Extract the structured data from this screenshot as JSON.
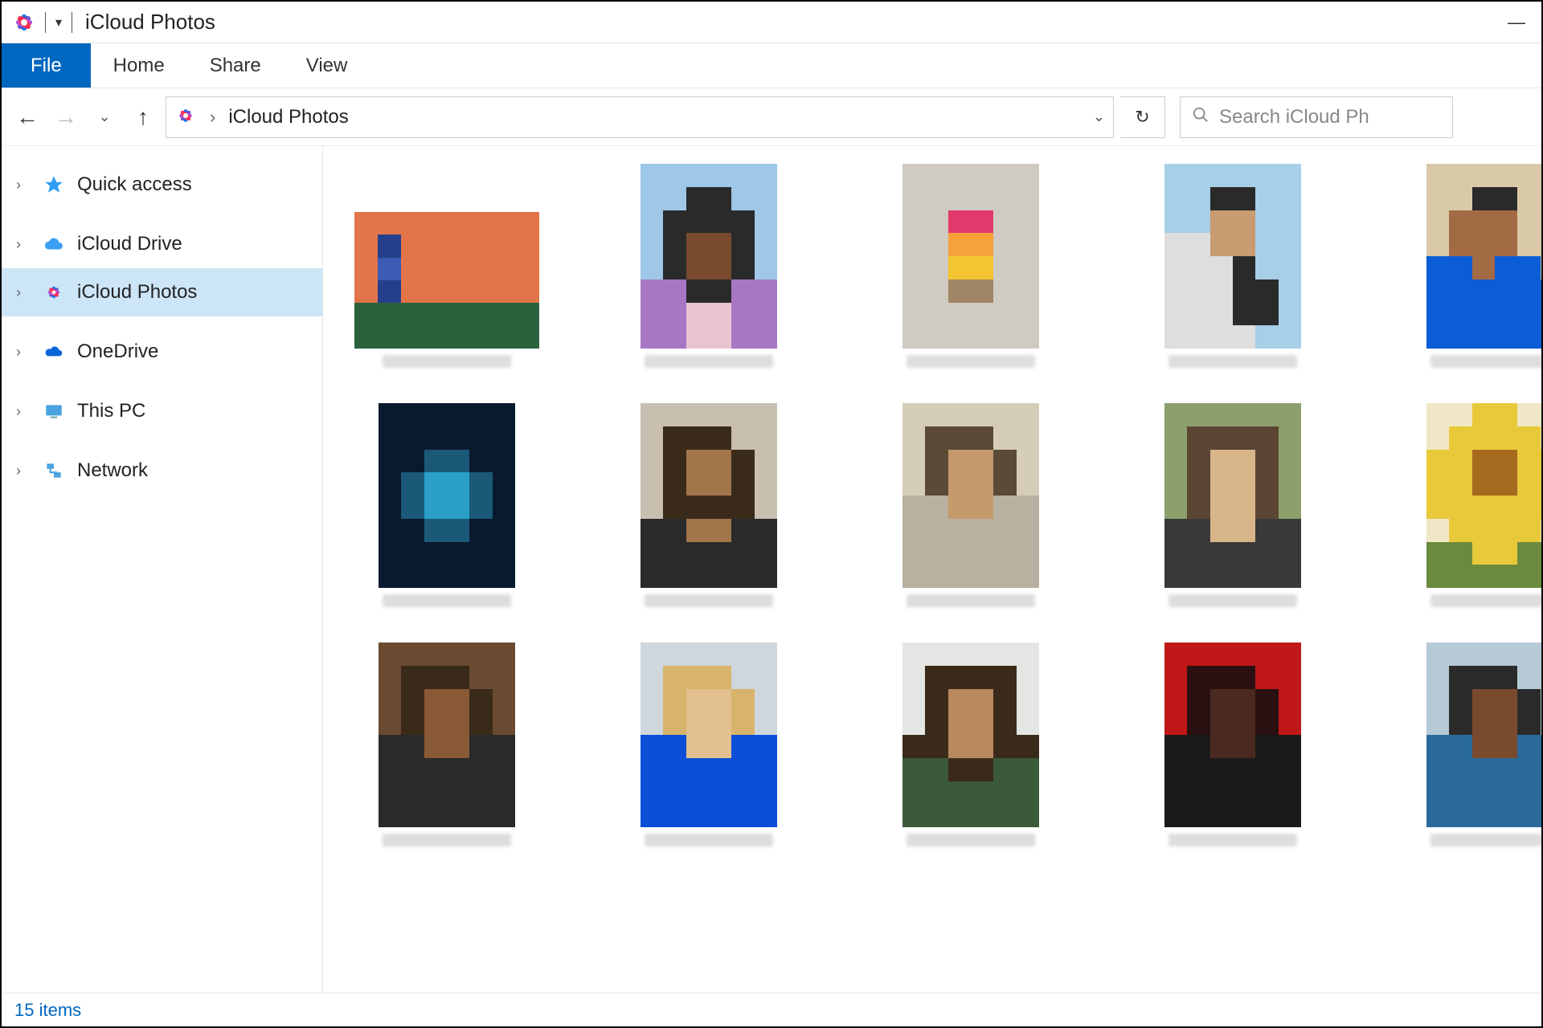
{
  "window": {
    "title": "iCloud Photos"
  },
  "ribbon": {
    "file": "File",
    "tabs": [
      "Home",
      "Share",
      "View"
    ]
  },
  "address": {
    "crumbs": [
      "iCloud Photos"
    ],
    "search_placeholder": "Search iCloud Ph"
  },
  "sidebar": {
    "items": [
      {
        "label": "Quick access",
        "icon": "star"
      },
      {
        "label": "iCloud Drive",
        "icon": "cloud"
      },
      {
        "label": "iCloud Photos",
        "icon": "photos",
        "selected": true
      },
      {
        "label": "OneDrive",
        "icon": "onedrive"
      },
      {
        "label": "This PC",
        "icon": "pc"
      },
      {
        "label": "Network",
        "icon": "network"
      }
    ]
  },
  "status": {
    "text": "15 items"
  },
  "thumbs": [
    {
      "shape": "landscape",
      "palette": [
        "#e2744a",
        "#e2744a",
        "#e2744a",
        "#e2744a",
        "#e2744a",
        "#e2744a",
        "#e2744a",
        "#e2744a",
        "#e2744a",
        "#25408a",
        "#e2744a",
        "#e2744a",
        "#e2744a",
        "#e2744a",
        "#e2744a",
        "#e2744a",
        "#e2744a",
        "#3b5bb5",
        "#e2744a",
        "#e2744a",
        "#e2744a",
        "#e2744a",
        "#e2744a",
        "#e2744a",
        "#e2744a",
        "#263f8a",
        "#e2744a",
        "#e2744a",
        "#e2744a",
        "#e2744a",
        "#e2744a",
        "#e2744a",
        "#2a623d",
        "#2a623d",
        "#2a623d",
        "#2a623d",
        "#2a623d",
        "#2a623d",
        "#2a623d",
        "#2a623d",
        "#2a623d",
        "#2a623d",
        "#2a623d",
        "#2a623d",
        "#2a623d",
        "#2a623d",
        "#2a623d",
        "#2a623d"
      ]
    },
    {
      "shape": "portrait",
      "palette": [
        "#9ec7e8",
        "#9ec7e8",
        "#9ec7e8",
        "#9ec7e8",
        "#9ec7e8",
        "#9ec7e8",
        "#9ec7e8",
        "#9ec7e8",
        "#2a2a2a",
        "#2a2a2a",
        "#9ec7e8",
        "#9ec7e8",
        "#9ec7e8",
        "#2a2a2a",
        "#2a2a2a",
        "#2a2a2a",
        "#2a2a2a",
        "#9ec7e8",
        "#9ec7e8",
        "#2a2a2a",
        "#7a4a2f",
        "#7a4a2f",
        "#2a2a2a",
        "#9ec7e8",
        "#9ec7e8",
        "#2a2a2a",
        "#7a4a2f",
        "#7a4a2f",
        "#2a2a2a",
        "#9ec7e8",
        "#a877c4",
        "#a877c4",
        "#2a2a2a",
        "#2a2a2a",
        "#a877c4",
        "#a877c4",
        "#a877c4",
        "#a877c4",
        "#eac3d2",
        "#eac3d2",
        "#a877c4",
        "#a877c4",
        "#a877c4",
        "#a877c4",
        "#eac3d2",
        "#eac3d2",
        "#a877c4",
        "#a877c4"
      ]
    },
    {
      "shape": "portrait",
      "palette": [
        "#cfcac2",
        "#cfcac2",
        "#cfcac2",
        "#cfcac2",
        "#cfcac2",
        "#cfcac2",
        "#cfcac2",
        "#cfcac2",
        "#cfcac2",
        "#cfcac2",
        "#cfcac2",
        "#cfcac2",
        "#cfcac2",
        "#cfcac2",
        "#e33a6d",
        "#e33a6d",
        "#cfcac2",
        "#cfcac2",
        "#cfcac2",
        "#cfcac2",
        "#f6a13a",
        "#f6a13a",
        "#cfcac2",
        "#cfcac2",
        "#cfcac2",
        "#cfcac2",
        "#f2c531",
        "#f2c531",
        "#cfcac2",
        "#cfcac2",
        "#cfcac2",
        "#cfcac2",
        "#a08664",
        "#a08664",
        "#cfcac2",
        "#cfcac2",
        "#cfcac2",
        "#cfcac2",
        "#cfcac2",
        "#cfcac2",
        "#cfcac2",
        "#cfcac2",
        "#cfcac2",
        "#cfcac2",
        "#cfcac2",
        "#cfcac2",
        "#cfcac2",
        "#cfcac2"
      ]
    },
    {
      "shape": "portrait",
      "palette": [
        "#a7cfe8",
        "#a7cfe8",
        "#a7cfe8",
        "#a7cfe8",
        "#a7cfe8",
        "#a7cfe8",
        "#a7cfe8",
        "#a7cfe8",
        "#2a2a2a",
        "#2a2a2a",
        "#a7cfe8",
        "#a7cfe8",
        "#a7cfe8",
        "#a7cfe8",
        "#c89b70",
        "#c89b70",
        "#a7cfe8",
        "#a7cfe8",
        "#dedede",
        "#dedede",
        "#c89b70",
        "#c89b70",
        "#a7cfe8",
        "#a7cfe8",
        "#dedede",
        "#dedede",
        "#dedede",
        "#2a2a2a",
        "#a7cfe8",
        "#a7cfe8",
        "#dedede",
        "#dedede",
        "#dedede",
        "#2a2a2a",
        "#2a2a2a",
        "#a7cfe8",
        "#dedede",
        "#dedede",
        "#dedede",
        "#2a2a2a",
        "#2a2a2a",
        "#a7cfe8",
        "#dedede",
        "#dedede",
        "#dedede",
        "#dedede",
        "#a7cfe8",
        "#a7cfe8"
      ]
    },
    {
      "shape": "portrait",
      "palette": [
        "#d9c9a8",
        "#d9c9a8",
        "#d9c9a8",
        "#d9c9a8",
        "#d9c9a8",
        "#d9c9a8",
        "#d9c9a8",
        "#d9c9a8",
        "#2a2a2a",
        "#2a2a2a",
        "#d9c9a8",
        "#d9c9a8",
        "#d9c9a8",
        "#a26b43",
        "#a26b43",
        "#a26b43",
        "#d9c9a8",
        "#d9c9a8",
        "#d9c9a8",
        "#a26b43",
        "#a26b43",
        "#a26b43",
        "#d9c9a8",
        "#d9c9a8",
        "#0b5cd6",
        "#0b5cd6",
        "#a26b43",
        "#0b5cd6",
        "#0b5cd6",
        "#d9c9a8",
        "#0b5cd6",
        "#0b5cd6",
        "#0b5cd6",
        "#0b5cd6",
        "#0b5cd6",
        "#0b5cd6",
        "#0b5cd6",
        "#0b5cd6",
        "#0b5cd6",
        "#0b5cd6",
        "#0b5cd6",
        "#0b5cd6",
        "#0b5cd6",
        "#0b5cd6",
        "#0b5cd6",
        "#0b5cd6",
        "#0b5cd6",
        "#0b5cd6"
      ]
    },
    {
      "shape": "portrait",
      "palette": [
        "#0a1a2e",
        "#0a1a2e",
        "#0a1a2e",
        "#0a1a2e",
        "#0a1a2e",
        "#0a1a2e",
        "#0a1a2e",
        "#0a1a2e",
        "#0a1a2e",
        "#0a1a2e",
        "#0a1a2e",
        "#0a1a2e",
        "#0a1a2e",
        "#0a1a2e",
        "#1a5a78",
        "#1a5a78",
        "#0a1a2e",
        "#0a1a2e",
        "#0a1a2e",
        "#1a5a78",
        "#2aa0c8",
        "#2aa0c8",
        "#1a5a78",
        "#0a1a2e",
        "#0a1a2e",
        "#1a5a78",
        "#2aa0c8",
        "#2aa0c8",
        "#1a5a78",
        "#0a1a2e",
        "#0a1a2e",
        "#0a1a2e",
        "#1a5a78",
        "#1a5a78",
        "#0a1a2e",
        "#0a1a2e",
        "#0a1a2e",
        "#0a1a2e",
        "#0a1a2e",
        "#0a1a2e",
        "#0a1a2e",
        "#0a1a2e",
        "#0a1a2e",
        "#0a1a2e",
        "#0a1a2e",
        "#0a1a2e",
        "#0a1a2e",
        "#0a1a2e"
      ]
    },
    {
      "shape": "portrait",
      "palette": [
        "#c9bfb0",
        "#c9bfb0",
        "#c9bfb0",
        "#c9bfb0",
        "#c9bfb0",
        "#c9bfb0",
        "#c9bfb0",
        "#3a2a1a",
        "#3a2a1a",
        "#3a2a1a",
        "#c9bfb0",
        "#c9bfb0",
        "#c9bfb0",
        "#3a2a1a",
        "#a2754b",
        "#a2754b",
        "#3a2a1a",
        "#c9bfb0",
        "#c9bfb0",
        "#3a2a1a",
        "#a2754b",
        "#a2754b",
        "#3a2a1a",
        "#c9bfb0",
        "#c9bfb0",
        "#3a2a1a",
        "#3a2a1a",
        "#3a2a1a",
        "#3a2a1a",
        "#c9bfb0",
        "#2a2a2a",
        "#2a2a2a",
        "#a2754b",
        "#a2754b",
        "#2a2a2a",
        "#2a2a2a",
        "#2a2a2a",
        "#2a2a2a",
        "#2a2a2a",
        "#2a2a2a",
        "#2a2a2a",
        "#2a2a2a",
        "#2a2a2a",
        "#2a2a2a",
        "#2a2a2a",
        "#2a2a2a",
        "#2a2a2a",
        "#2a2a2a"
      ]
    },
    {
      "shape": "portrait",
      "palette": [
        "#d6cdb9",
        "#d6cdb9",
        "#d6cdb9",
        "#d6cdb9",
        "#d6cdb9",
        "#d6cdb9",
        "#d6cdb9",
        "#5a4a36",
        "#5a4a36",
        "#5a4a36",
        "#d6cdb9",
        "#d6cdb9",
        "#d6cdb9",
        "#5a4a36",
        "#c59a6d",
        "#c59a6d",
        "#5a4a36",
        "#d6cdb9",
        "#d6cdb9",
        "#5a4a36",
        "#c59a6d",
        "#c59a6d",
        "#5a4a36",
        "#d6cdb9",
        "#b8b0a0",
        "#b8b0a0",
        "#c59a6d",
        "#c59a6d",
        "#b8b0a0",
        "#b8b0a0",
        "#b8b0a0",
        "#b8b0a0",
        "#b8b0a0",
        "#b8b0a0",
        "#b8b0a0",
        "#b8b0a0",
        "#b8b0a0",
        "#b8b0a0",
        "#b8b0a0",
        "#b8b0a0",
        "#b8b0a0",
        "#b8b0a0",
        "#b8b0a0",
        "#b8b0a0",
        "#b8b0a0",
        "#b8b0a0",
        "#b8b0a0",
        "#b8b0a0"
      ]
    },
    {
      "shape": "portrait",
      "palette": [
        "#8c9f6d",
        "#8c9f6d",
        "#8c9f6d",
        "#8c9f6d",
        "#8c9f6d",
        "#8c9f6d",
        "#8c9f6d",
        "#5a4633",
        "#5a4633",
        "#5a4633",
        "#5a4633",
        "#8c9f6d",
        "#8c9f6d",
        "#5a4633",
        "#d9b58a",
        "#d9b58a",
        "#5a4633",
        "#8c9f6d",
        "#8c9f6d",
        "#5a4633",
        "#d9b58a",
        "#d9b58a",
        "#5a4633",
        "#8c9f6d",
        "#8c9f6d",
        "#5a4633",
        "#d9b58a",
        "#d9b58a",
        "#5a4633",
        "#8c9f6d",
        "#3a3a3a",
        "#3a3a3a",
        "#d9b58a",
        "#d9b58a",
        "#3a3a3a",
        "#3a3a3a",
        "#3a3a3a",
        "#3a3a3a",
        "#3a3a3a",
        "#3a3a3a",
        "#3a3a3a",
        "#3a3a3a",
        "#3a3a3a",
        "#3a3a3a",
        "#3a3a3a",
        "#3a3a3a",
        "#3a3a3a",
        "#3a3a3a"
      ]
    },
    {
      "shape": "portrait",
      "palette": [
        "#efe7c5",
        "#efe7c5",
        "#e8c93a",
        "#e8c93a",
        "#efe7c5",
        "#efe7c5",
        "#efe7c5",
        "#e8c93a",
        "#e8c93a",
        "#e8c93a",
        "#e8c93a",
        "#efe7c5",
        "#e8c93a",
        "#e8c93a",
        "#a66a1f",
        "#a66a1f",
        "#e8c93a",
        "#e8c93a",
        "#e8c93a",
        "#e8c93a",
        "#a66a1f",
        "#a66a1f",
        "#e8c93a",
        "#e8c93a",
        "#e8c93a",
        "#e8c93a",
        "#e8c93a",
        "#e8c93a",
        "#e8c93a",
        "#e8c93a",
        "#efe7c5",
        "#e8c93a",
        "#e8c93a",
        "#e8c93a",
        "#e8c93a",
        "#efe7c5",
        "#6a8a3e",
        "#6a8a3e",
        "#e8c93a",
        "#e8c93a",
        "#6a8a3e",
        "#6a8a3e",
        "#6a8a3e",
        "#6a8a3e",
        "#6a8a3e",
        "#6a8a3e",
        "#6a8a3e",
        "#6a8a3e"
      ]
    },
    {
      "shape": "portrait",
      "palette": [
        "#6a4a30",
        "#6a4a30",
        "#6a4a30",
        "#6a4a30",
        "#6a4a30",
        "#6a4a30",
        "#6a4a30",
        "#3a2a1a",
        "#3a2a1a",
        "#3a2a1a",
        "#6a4a30",
        "#6a4a30",
        "#6a4a30",
        "#3a2a1a",
        "#8a5a36",
        "#8a5a36",
        "#3a2a1a",
        "#6a4a30",
        "#6a4a30",
        "#3a2a1a",
        "#8a5a36",
        "#8a5a36",
        "#3a2a1a",
        "#6a4a30",
        "#2a2a2a",
        "#2a2a2a",
        "#8a5a36",
        "#8a5a36",
        "#2a2a2a",
        "#2a2a2a",
        "#2a2a2a",
        "#2a2a2a",
        "#2a2a2a",
        "#2a2a2a",
        "#2a2a2a",
        "#2a2a2a",
        "#2a2a2a",
        "#2a2a2a",
        "#2a2a2a",
        "#2a2a2a",
        "#2a2a2a",
        "#2a2a2a",
        "#2a2a2a",
        "#2a2a2a",
        "#2a2a2a",
        "#2a2a2a",
        "#2a2a2a",
        "#2a2a2a"
      ]
    },
    {
      "shape": "portrait",
      "palette": [
        "#cfd6dc",
        "#cfd6dc",
        "#cfd6dc",
        "#cfd6dc",
        "#cfd6dc",
        "#cfd6dc",
        "#cfd6dc",
        "#d7b36b",
        "#d7b36b",
        "#d7b36b",
        "#cfd6dc",
        "#cfd6dc",
        "#cfd6dc",
        "#d7b36b",
        "#e2c08f",
        "#e2c08f",
        "#d7b36b",
        "#cfd6dc",
        "#cfd6dc",
        "#d7b36b",
        "#e2c08f",
        "#e2c08f",
        "#d7b36b",
        "#cfd6dc",
        "#0c4fd6",
        "#0c4fd6",
        "#e2c08f",
        "#e2c08f",
        "#0c4fd6",
        "#0c4fd6",
        "#0c4fd6",
        "#0c4fd6",
        "#0c4fd6",
        "#0c4fd6",
        "#0c4fd6",
        "#0c4fd6",
        "#0c4fd6",
        "#0c4fd6",
        "#0c4fd6",
        "#0c4fd6",
        "#0c4fd6",
        "#0c4fd6",
        "#0c4fd6",
        "#0c4fd6",
        "#0c4fd6",
        "#0c4fd6",
        "#0c4fd6",
        "#0c4fd6"
      ]
    },
    {
      "shape": "portrait",
      "palette": [
        "#e4e6e4",
        "#e4e6e4",
        "#e4e6e4",
        "#e4e6e4",
        "#e4e6e4",
        "#e4e6e4",
        "#e4e6e4",
        "#3a2a1a",
        "#3a2a1a",
        "#3a2a1a",
        "#3a2a1a",
        "#e4e6e4",
        "#e4e6e4",
        "#3a2a1a",
        "#b9885d",
        "#b9885d",
        "#3a2a1a",
        "#e4e6e4",
        "#e4e6e4",
        "#3a2a1a",
        "#b9885d",
        "#b9885d",
        "#3a2a1a",
        "#e4e6e4",
        "#3a2a1a",
        "#3a2a1a",
        "#b9885d",
        "#b9885d",
        "#3a2a1a",
        "#3a2a1a",
        "#3a5a3a",
        "#3a5a3a",
        "#3a2a1a",
        "#3a2a1a",
        "#3a5a3a",
        "#3a5a3a",
        "#3a5a3a",
        "#3a5a3a",
        "#3a5a3a",
        "#3a5a3a",
        "#3a5a3a",
        "#3a5a3a",
        "#3a5a3a",
        "#3a5a3a",
        "#3a5a3a",
        "#3a5a3a",
        "#3a5a3a",
        "#3a5a3a"
      ]
    },
    {
      "shape": "portrait",
      "palette": [
        "#c01818",
        "#c01818",
        "#c01818",
        "#c01818",
        "#c01818",
        "#c01818",
        "#c01818",
        "#2a1010",
        "#2a1010",
        "#2a1010",
        "#c01818",
        "#c01818",
        "#c01818",
        "#2a1010",
        "#4a2a20",
        "#4a2a20",
        "#2a1010",
        "#c01818",
        "#c01818",
        "#2a1010",
        "#4a2a20",
        "#4a2a20",
        "#2a1010",
        "#c01818",
        "#1a1a1a",
        "#1a1a1a",
        "#4a2a20",
        "#4a2a20",
        "#1a1a1a",
        "#1a1a1a",
        "#1a1a1a",
        "#1a1a1a",
        "#1a1a1a",
        "#1a1a1a",
        "#1a1a1a",
        "#1a1a1a",
        "#1a1a1a",
        "#1a1a1a",
        "#1a1a1a",
        "#1a1a1a",
        "#1a1a1a",
        "#1a1a1a",
        "#1a1a1a",
        "#1a1a1a",
        "#1a1a1a",
        "#1a1a1a",
        "#1a1a1a",
        "#1a1a1a"
      ]
    },
    {
      "shape": "portrait",
      "palette": [
        "#b6c9d6",
        "#b6c9d6",
        "#b6c9d6",
        "#b6c9d6",
        "#b6c9d6",
        "#b6c9d6",
        "#b6c9d6",
        "#2a2a2a",
        "#2a2a2a",
        "#2a2a2a",
        "#b6c9d6",
        "#b6c9d6",
        "#b6c9d6",
        "#2a2a2a",
        "#7a4a2f",
        "#7a4a2f",
        "#2a2a2a",
        "#b6c9d6",
        "#b6c9d6",
        "#2a2a2a",
        "#7a4a2f",
        "#7a4a2f",
        "#2a2a2a",
        "#b6c9d6",
        "#2a6a9a",
        "#2a6a9a",
        "#7a4a2f",
        "#7a4a2f",
        "#2a6a9a",
        "#2a6a9a",
        "#2a6a9a",
        "#2a6a9a",
        "#2a6a9a",
        "#2a6a9a",
        "#2a6a9a",
        "#2a6a9a",
        "#2a6a9a",
        "#2a6a9a",
        "#2a6a9a",
        "#2a6a9a",
        "#2a6a9a",
        "#2a6a9a",
        "#2a6a9a",
        "#2a6a9a",
        "#2a6a9a",
        "#2a6a9a",
        "#2a6a9a",
        "#2a6a9a"
      ]
    }
  ]
}
